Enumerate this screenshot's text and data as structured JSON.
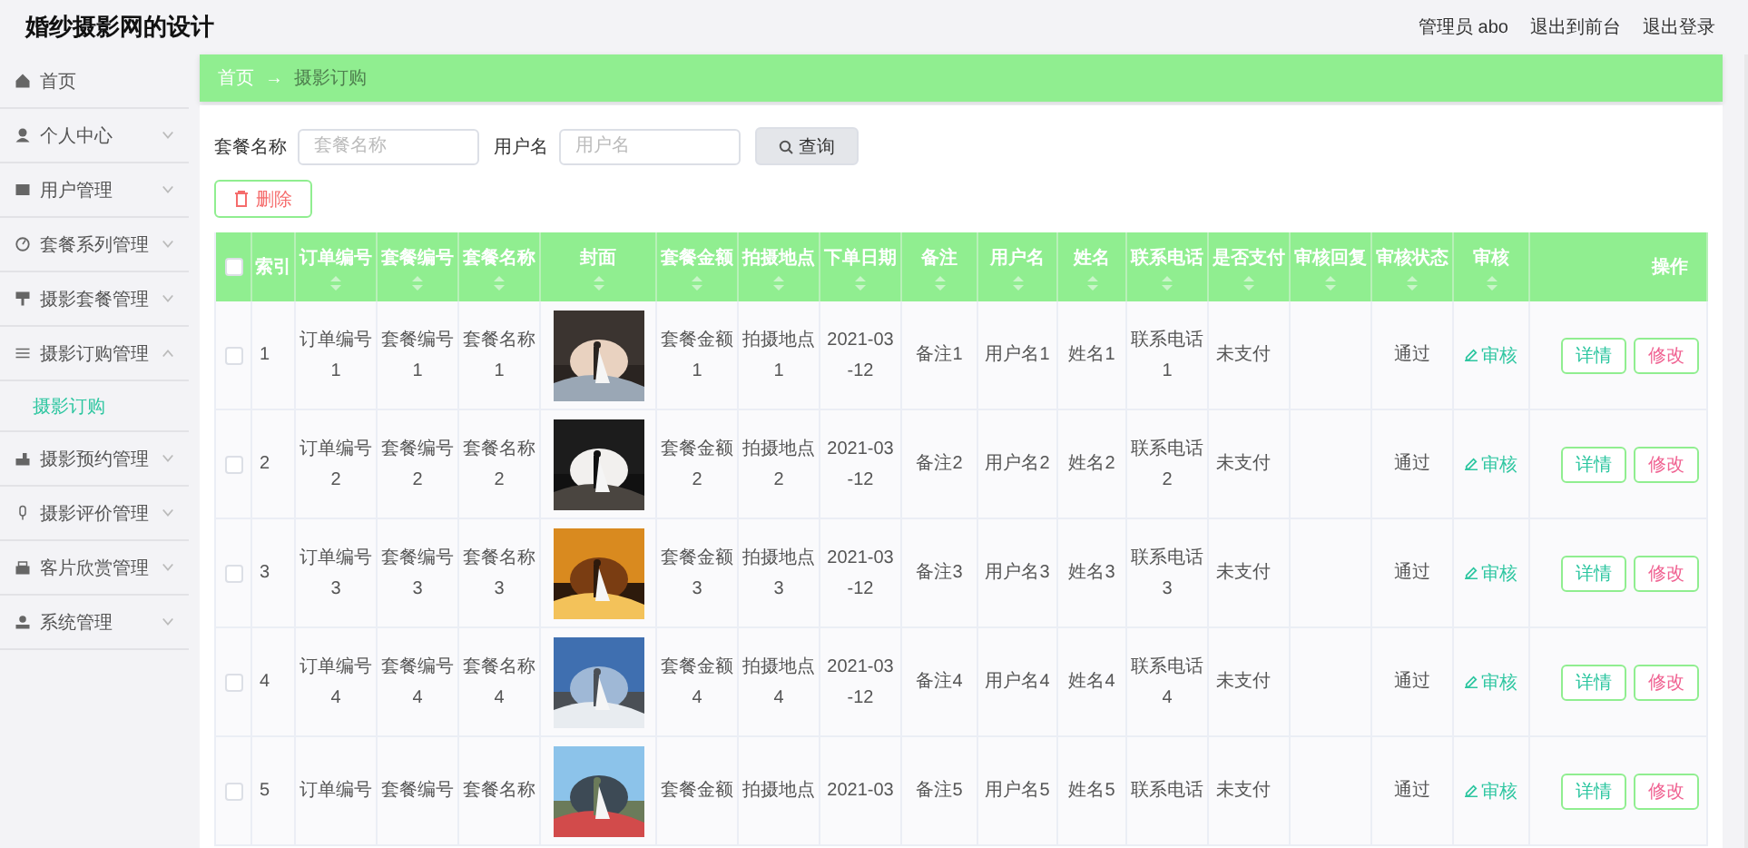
{
  "header": {
    "title": "婚纱摄影网的设计",
    "links": [
      "管理员 abo",
      "退出到前台",
      "退出登录"
    ]
  },
  "sidebar": {
    "items": [
      {
        "label": "首页",
        "kind": "link"
      },
      {
        "label": "个人中心",
        "kind": "menu",
        "expanded": false
      },
      {
        "label": "用户管理",
        "kind": "menu",
        "expanded": false
      },
      {
        "label": "套餐系列管理",
        "kind": "menu",
        "expanded": false
      },
      {
        "label": "摄影套餐管理",
        "kind": "menu",
        "expanded": false
      },
      {
        "label": "摄影订购管理",
        "kind": "menu",
        "expanded": true,
        "children": [
          {
            "label": "摄影订购",
            "selected": true
          }
        ]
      },
      {
        "label": "摄影预约管理",
        "kind": "menu",
        "expanded": false
      },
      {
        "label": "摄影评价管理",
        "kind": "menu",
        "expanded": false
      },
      {
        "label": "客片欣赏管理",
        "kind": "menu",
        "expanded": false
      },
      {
        "label": "系统管理",
        "kind": "menu",
        "expanded": false
      }
    ]
  },
  "breadcrumb": {
    "items": [
      "首页",
      "摄影订购"
    ],
    "separator": "→"
  },
  "search": {
    "fields": [
      {
        "label": "套餐名称",
        "placeholder": "套餐名称"
      },
      {
        "label": "用户名",
        "placeholder": "用户名"
      }
    ],
    "button": "查询"
  },
  "delete_button": "删除",
  "table": {
    "select_all_checked": false,
    "columns": [
      {
        "label": "索引",
        "sortable": false
      },
      {
        "label": "订单编号",
        "sortable": true
      },
      {
        "label": "套餐编号",
        "sortable": true
      },
      {
        "label": "套餐名称",
        "sortable": true
      },
      {
        "label": "封面",
        "sortable": true
      },
      {
        "label": "套餐金额",
        "sortable": true
      },
      {
        "label": "拍摄地点",
        "sortable": true
      },
      {
        "label": "下单日期",
        "sortable": true
      },
      {
        "label": "备注",
        "sortable": true
      },
      {
        "label": "用户名",
        "sortable": true
      },
      {
        "label": "姓名",
        "sortable": true
      },
      {
        "label": "联系电话",
        "sortable": true
      },
      {
        "label": "是否支付",
        "sortable": true
      },
      {
        "label": "审核回复",
        "sortable": true
      },
      {
        "label": "审核状态",
        "sortable": true
      },
      {
        "label": "审核",
        "sortable": true
      },
      {
        "label": "操作",
        "sortable": false
      }
    ],
    "rows": [
      {
        "checked": false,
        "cells": [
          "1",
          "订单编号 1",
          "套餐编号 1",
          "套餐名称 1",
          {
            "kind": "picture"
          },
          "套餐金额 1",
          "拍摄地点 1",
          "2021-03-12",
          "备注1",
          "用户名1",
          "姓名1",
          "联系电话 1",
          "未支付",
          "",
          "通过",
          {
            "kind": "link",
            "label": "审核"
          },
          {
            "kind": "actions",
            "buttons": [
              "详情",
              "修改"
            ]
          }
        ]
      },
      {
        "checked": false,
        "cells": [
          "2",
          "订单编号 2",
          "套餐编号 2",
          "套餐名称 2",
          {
            "kind": "picture"
          },
          "套餐金额 2",
          "拍摄地点 2",
          "2021-03-12",
          "备注2",
          "用户名2",
          "姓名2",
          "联系电话 2",
          "未支付",
          "",
          "通过",
          {
            "kind": "link",
            "label": "审核"
          },
          {
            "kind": "actions",
            "buttons": [
              "详情",
              "修改"
            ]
          }
        ]
      },
      {
        "checked": false,
        "cells": [
          "3",
          "订单编号 3",
          "套餐编号 3",
          "套餐名称 3",
          {
            "kind": "picture"
          },
          "套餐金额 3",
          "拍摄地点 3",
          "2021-03-12",
          "备注3",
          "用户名3",
          "姓名3",
          "联系电话 3",
          "未支付",
          "",
          "通过",
          {
            "kind": "link",
            "label": "审核"
          },
          {
            "kind": "actions",
            "buttons": [
              "详情",
              "修改"
            ]
          }
        ]
      },
      {
        "checked": false,
        "cells": [
          "4",
          "订单编号 4",
          "套餐编号 4",
          "套餐名称 4",
          {
            "kind": "picture"
          },
          "套餐金额 4",
          "拍摄地点 4",
          "2021-03-12",
          "备注4",
          "用户名4",
          "姓名4",
          "联系电话 4",
          "未支付",
          "",
          "通过",
          {
            "kind": "link",
            "label": "审核"
          },
          {
            "kind": "actions",
            "buttons": [
              "详情",
              "修改"
            ]
          }
        ]
      },
      {
        "checked": false,
        "cells": [
          "5",
          "订单编号",
          "套餐编号",
          "套餐名称",
          {
            "kind": "picture"
          },
          "套餐金额",
          "拍摄地点",
          "2021-03",
          "备注5",
          "用户名5",
          "姓名5",
          "联系电话",
          "未支付",
          "",
          "通过",
          {
            "kind": "link",
            "label": "审核"
          },
          {
            "kind": "actions",
            "buttons": [
              "详情",
              "修改"
            ]
          }
        ]
      }
    ]
  }
}
